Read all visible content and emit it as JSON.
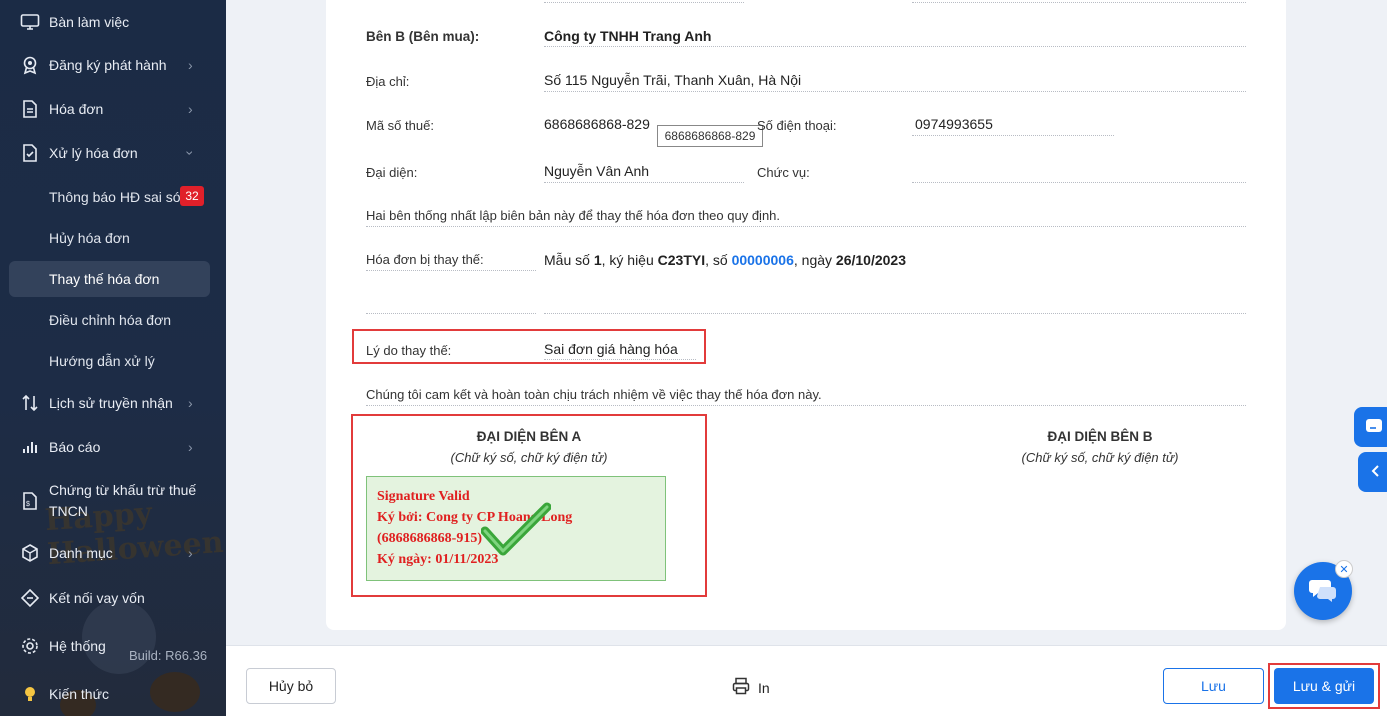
{
  "sidebar": {
    "items": [
      {
        "label": "Bàn làm việc",
        "icon": "monitor-icon"
      },
      {
        "label": "Đăng ký phát hành",
        "icon": "badge-icon"
      },
      {
        "label": "Hóa đơn",
        "icon": "document-icon"
      },
      {
        "label": "Xử lý hóa đơn",
        "icon": "document-check-icon"
      },
      {
        "label": "Lịch sử truyền nhận",
        "icon": "arrows-updown-icon"
      },
      {
        "label": "Báo cáo",
        "icon": "bar-chart-icon"
      },
      {
        "label": "Chứng từ khấu trừ thuế",
        "label2": "TNCN",
        "icon": "tax-document-icon"
      },
      {
        "label": "Danh mục",
        "icon": "cube-icon"
      },
      {
        "label": "Kết nối vay vốn",
        "icon": "link-icon"
      },
      {
        "label": "Hệ thống",
        "icon": "gear-icon"
      },
      {
        "label": "Kiến thức",
        "icon": "lightbulb-icon"
      }
    ],
    "subitems": [
      {
        "label": "Thông báo HĐ sai sót",
        "badge": "32"
      },
      {
        "label": "Hủy hóa đơn"
      },
      {
        "label": "Thay thế hóa đơn"
      },
      {
        "label": "Điều chỉnh hóa đơn"
      },
      {
        "label": "Hướng dẫn xử lý"
      }
    ],
    "build": "Build: R66.36",
    "decor_text": "Happy Halloween",
    "active_color": "#33425b",
    "bg_color": "#1b2b45"
  },
  "form": {
    "buyer_label": "Bên B (Bên mua):",
    "buyer_value": "Công ty TNHH Trang Anh",
    "address_label": "Địa chỉ:",
    "address_value": "Số 115 Nguyễn Trãi, Thanh Xuân, Hà Nội",
    "taxcode_label": "Mã số thuế:",
    "taxcode_value": "6868686868-829",
    "taxcode_tooltip": "6868686868-829",
    "phone_label": "Số điện thoại:",
    "phone_value": "0974993655",
    "rep_label": "Đại diện:",
    "rep_value": "Nguyễn Vân Anh",
    "position_label": "Chức vụ:",
    "agreement_text": "Hai bên thống nhất lập biên bản này để thay thế hóa đơn theo quy định.",
    "replaced_label": "Hóa đơn bị thay thế:",
    "replaced": {
      "form_prefix": "Mẫu số ",
      "form_no": "1",
      "symbol_prefix": ", ký hiệu ",
      "symbol": "C23TYI",
      "number_prefix": ", số ",
      "number": "00000006",
      "date_prefix": ", ngày ",
      "date": "26/10/2023"
    },
    "reason_label": "Lý do thay thế:",
    "reason_value": "Sai đơn giá hàng hóa",
    "commit_text": "Chúng tôi cam kết và hoàn toàn chịu trách nhiệm về việc thay thế hóa đơn này.",
    "sign_a_title": "ĐẠI DIỆN BÊN A",
    "sign_a_sub": "(Chữ ký số, chữ ký điện tử)",
    "sign_b_title": "ĐẠI DIỆN BÊN B",
    "sign_b_sub": "(Chữ ký số, chữ ký điện tử)",
    "signature": {
      "line1": "Signature Valid",
      "line2": "Ký bởi: Cong ty CP Hoang Long",
      "line3": "(6868686868-915)",
      "line4": "Ký ngày: 01/11/2023"
    },
    "link_color": "#1a73e8",
    "highlight_color": "#e23b3b"
  },
  "footer": {
    "cancel_label": "Hủy bỏ",
    "print_label": "In",
    "save_label": "Lưu",
    "save_send_label": "Lưu & gửi"
  }
}
